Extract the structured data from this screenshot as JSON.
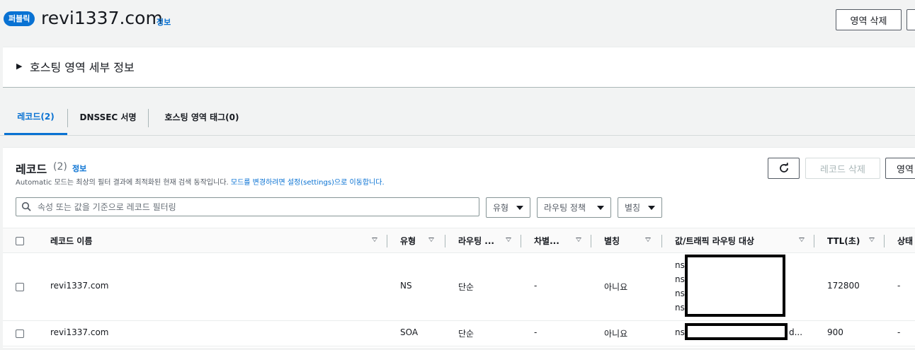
{
  "header": {
    "badge": "퍼블릭",
    "title": "revi1337.com",
    "info": "정보",
    "delete_zone_label": "영역 삭제"
  },
  "details": {
    "title": "호스팅 영역 세부 정보"
  },
  "tabs": [
    {
      "label": "레코드(2)",
      "active": true
    },
    {
      "label": "DNSSEC 서명",
      "active": false
    },
    {
      "label": "호스팅 영역 태그(0)",
      "active": false
    }
  ],
  "records": {
    "title": "레코드",
    "count": "(2)",
    "info": "정보",
    "desc_prefix": "Automatic 모드는 최상의 필터 결과에 최적화된 현재 검색 동작입니다.",
    "desc_link": "모드를 변경하려면 설정(settings)으로 이동합니다.",
    "delete_label": "레코드 삭제",
    "import_label": "영역",
    "search_placeholder": "속성 또는 값을 기준으로 레코드 필터링",
    "filters": {
      "type": "유형",
      "routing": "라우팅 정책",
      "alias": "별칭"
    }
  },
  "table": {
    "columns": {
      "name": "레코드 이름",
      "type": "유형",
      "routing": "라우팅 ...",
      "diff": "차별...",
      "alias": "별칭",
      "value": "값/트래픽 라우팅 대상",
      "ttl": "TTL(초)",
      "status": "상태"
    },
    "rows": [
      {
        "name": "revi1337.com",
        "type": "NS",
        "routing": "단순",
        "diff": "-",
        "alias": "아니요",
        "value_lines": [
          "ns",
          "ns",
          "ns",
          "ns"
        ],
        "ttl": "172800",
        "status": "-"
      },
      {
        "name": "revi1337.com",
        "type": "SOA",
        "routing": "단순",
        "diff": "-",
        "alias": "아니요",
        "value_prefix": "ns-",
        "value_suffix": "d...",
        "ttl": "900",
        "status": "-"
      }
    ]
  }
}
